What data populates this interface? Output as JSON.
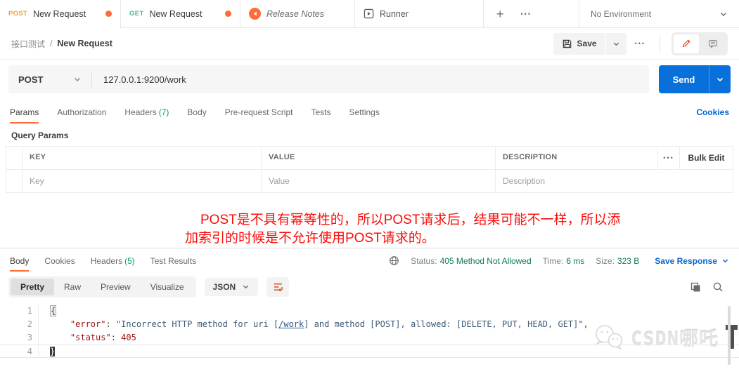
{
  "colors": {
    "accent_orange": "#FF6C37",
    "link_blue": "#0265D2",
    "send_blue": "#0870DB",
    "count_green": "#0C9A60",
    "status_green": "#0C7B53",
    "annotation_red": "#FA0E0A",
    "json_key": "#A31515",
    "json_string": "#3C5A77",
    "method_post_tab": "#E8A33D",
    "method_get_tab": "#3DBA84"
  },
  "tabbar": {
    "tabs": [
      {
        "method": "POST",
        "label": "New Request"
      },
      {
        "method": "GET",
        "label": "New Request"
      },
      {
        "label": "Release Notes"
      },
      {
        "label": "Runner"
      }
    ],
    "add_label": "+",
    "more_label": "•••",
    "environment": "No Environment"
  },
  "toolbar": {
    "breadcrumb_root": "接口测试",
    "breadcrumb_sep": "/",
    "breadcrumb_current": "New Request",
    "save_label": "Save",
    "more_label": "•••"
  },
  "request": {
    "method": "POST",
    "url": "127.0.0.1:9200/work",
    "send_label": "Send"
  },
  "request_tabs": {
    "items": [
      {
        "label": "Params"
      },
      {
        "label": "Authorization"
      },
      {
        "label": "Headers",
        "count": "(7)"
      },
      {
        "label": "Body"
      },
      {
        "label": "Pre-request Script"
      },
      {
        "label": "Tests"
      },
      {
        "label": "Settings"
      }
    ],
    "cookies_link": "Cookies"
  },
  "params": {
    "section_title": "Query Params",
    "columns": {
      "key": "KEY",
      "value": "VALUE",
      "description": "DESCRIPTION"
    },
    "more_label": "•••",
    "bulk_edit_label": "Bulk Edit",
    "placeholders": {
      "key": "Key",
      "value": "Value",
      "description": "Description"
    }
  },
  "annotation": {
    "lines": [
      "POST是不具有幂等性的，所以POST请求后，结果可能不一样，所以添",
      "加索引的时候是不允许使用POST请求的。"
    ]
  },
  "response": {
    "tabs": [
      {
        "label": "Body"
      },
      {
        "label": "Cookies"
      },
      {
        "label": "Headers",
        "count": "(5)"
      },
      {
        "label": "Test Results"
      }
    ],
    "status_label": "Status:",
    "status_value": "405 Method Not Allowed",
    "time_label": "Time:",
    "time_value": "6 ms",
    "size_label": "Size:",
    "size_value": "323 B",
    "save_response_label": "Save Response"
  },
  "viewer": {
    "modes": [
      "Pretty",
      "Raw",
      "Preview",
      "Visualize"
    ],
    "format_label": "JSON"
  },
  "code": {
    "lines": [
      {
        "num": "1",
        "segments": [
          {
            "t": "{",
            "cls": "brk"
          }
        ]
      },
      {
        "num": "2",
        "segments": [
          {
            "t": "    ",
            "cls": ""
          },
          {
            "t": "\"error\"",
            "cls": "key"
          },
          {
            "t": ": ",
            "cls": ""
          },
          {
            "t": "\"Incorrect HTTP method for uri [",
            "cls": "str"
          },
          {
            "t": "/work",
            "cls": "str lnk"
          },
          {
            "t": "] and method [POST], allowed: [DELETE, PUT, HEAD, GET]\"",
            "cls": "str"
          },
          {
            "t": ",",
            "cls": ""
          }
        ]
      },
      {
        "num": "3",
        "segments": [
          {
            "t": "    ",
            "cls": ""
          },
          {
            "t": "\"status\"",
            "cls": "key"
          },
          {
            "t": ": ",
            "cls": ""
          },
          {
            "t": "405",
            "cls": "numv"
          }
        ]
      },
      {
        "num": "4",
        "active": true,
        "segments": [
          {
            "t": "}",
            "cls": "cur"
          }
        ]
      }
    ]
  },
  "watermark": {
    "text": "CSDN哪吒"
  }
}
